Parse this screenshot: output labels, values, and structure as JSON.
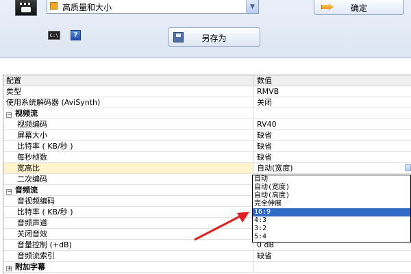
{
  "toolbar": {
    "preset_value": "高质量和大小",
    "ok_label": "确定",
    "saveas_label": "另存为",
    "cmd_icon_text": "C:\\",
    "help_icon_text": "?"
  },
  "grid": {
    "header": {
      "name": "配置",
      "value": "数值"
    },
    "rows": [
      {
        "name": "类型",
        "value": "RMVB"
      },
      {
        "name": "使用系统解码器 (AviSynth)",
        "value": "关闭"
      },
      {
        "name": "视频流",
        "value": ""
      },
      {
        "name": "视频编码",
        "value": "RV40"
      },
      {
        "name": "屏幕大小",
        "value": "缺省"
      },
      {
        "name": "比特率 ( KB/秒 )",
        "value": "缺省"
      },
      {
        "name": "每秒桢数",
        "value": "缺省"
      },
      {
        "name": "宽高比",
        "value": "自动(宽度)"
      },
      {
        "name": "二次编码",
        "value": ""
      },
      {
        "name": "音频流",
        "value": ""
      },
      {
        "name": "音视频编码",
        "value": ""
      },
      {
        "name": "比特率 ( KB/秒 )",
        "value": ""
      },
      {
        "name": "音频声道",
        "value": ""
      },
      {
        "name": "关闭音效",
        "value": ""
      },
      {
        "name": "音量控制 (+dB)",
        "value": "0 dB"
      },
      {
        "name": "音频流索引",
        "value": "缺省"
      },
      {
        "name": "附加字幕",
        "value": ""
      }
    ],
    "toggle_symbol": "−",
    "toggle_expand_symbol": "+"
  },
  "aspect_dropdown": {
    "options": [
      "自动",
      "自动(宽度)",
      "自动(高度)",
      "完全伸展",
      "16:9",
      "4:3",
      "3:2",
      "5:4"
    ],
    "selected_index": 4
  },
  "colors": {
    "selection": "#316ac5",
    "arrow": "#e02020"
  }
}
